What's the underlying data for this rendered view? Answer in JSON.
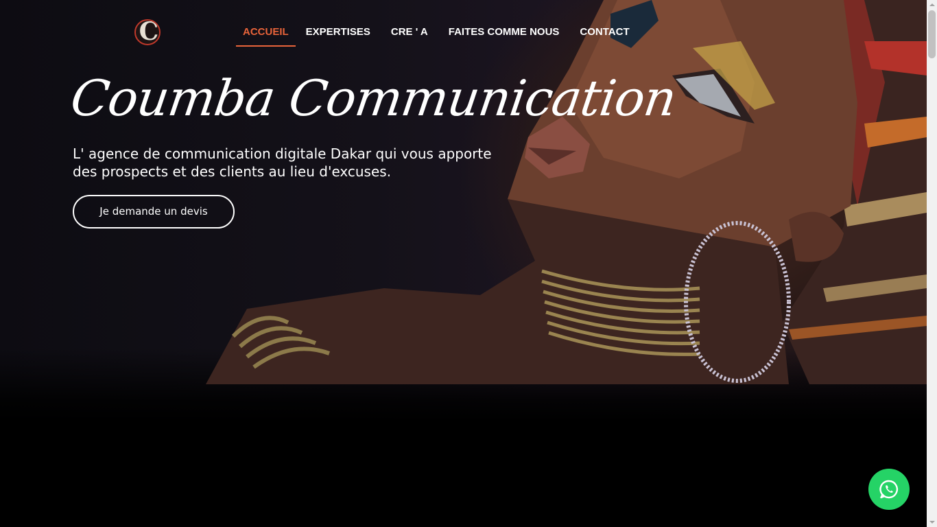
{
  "nav": {
    "logo_alt": "Coumba Communication logo",
    "items": [
      {
        "label": "ACCUEIL",
        "active": true
      },
      {
        "label": "EXPERTISES",
        "active": false
      },
      {
        "label": "CRE ' A",
        "active": false
      },
      {
        "label": "FAITES COMME NOUS",
        "active": false
      },
      {
        "label": "CONTACT",
        "active": false
      }
    ]
  },
  "hero": {
    "title": "Coumba Communication",
    "tagline": "L' agence de communication digitale Dakar qui vous apporte des prospects et des clients au lieu d'excuses.",
    "cta_label": "Je demande un devis"
  },
  "floating": {
    "icon": "whatsapp-icon",
    "color": "#25d366"
  },
  "colors": {
    "accent": "#e9643a",
    "background": "#000000",
    "text": "#ffffff"
  }
}
